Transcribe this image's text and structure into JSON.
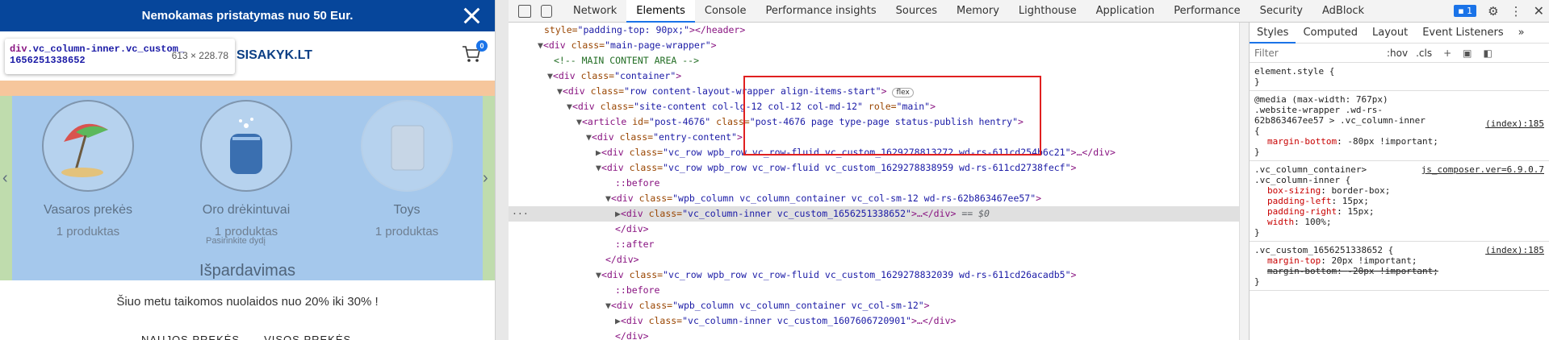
{
  "preview": {
    "promo_text": "Nemokamas pristatymas nuo 50 Eur.",
    "logo_text": "SISAKYK.LT",
    "cart_count": "0",
    "tooltip": {
      "selector_tag": "div",
      "selector_class": ".vc_column-inner.vc_custom_",
      "selector_id_line": "1656251338652",
      "size": "613 × 228.78"
    },
    "categories": [
      {
        "name": "Vasaros prekės",
        "count": "1 produktas",
        "icon": "beach-umbrella-icon"
      },
      {
        "name": "Oro drėkintuvai",
        "count": "1 produktas",
        "icon": "humidifier-icon"
      },
      {
        "name": "Toys",
        "count": "1 produktas",
        "icon": "toy-box-icon"
      }
    ],
    "sub_note": "Pasirinkite dydį",
    "sale_title": "Išpardavimas",
    "sale_subtitle": "Šiuo metu taikomos nuolaidos nuo 20% iki 30% !",
    "bottom_tabs": [
      "NAUJOS PREKĖS",
      "VISOS PREKĖS"
    ]
  },
  "devtools": {
    "tabs": [
      "Network",
      "Elements",
      "Console",
      "Performance insights",
      "Sources",
      "Memory",
      "Lighthouse",
      "Application",
      "Performance",
      "Security",
      "AdBlock"
    ],
    "active_tab": "Elements",
    "issues_count": "1",
    "styles_tabs": [
      "Styles",
      "Computed",
      "Layout",
      "Event Listeners",
      "»"
    ],
    "filter_placeholder": "Filter",
    "hov": ":hov",
    "cls": ".cls",
    "element_style": "element.style {",
    "media_query": "@media (max-width: 767px)",
    "rule1_selector_a": ".website-wrapper .wd-rs-",
    "rule1_selector_b": "62b863467ee57 > .vc_column-inner",
    "rule1_source": "(index):185",
    "rule1_prop": "margin-bottom",
    "rule1_val": "-80px !important;",
    "rule2_selector_a": ".vc_column_container>",
    "rule2_source": "js_composer.ver=6.9.0.7",
    "rule2_selector_b": ".vc_column-inner {",
    "rule2_props": [
      {
        "name": "box-sizing",
        "value": "border-box;"
      },
      {
        "name": "padding-left",
        "value": "15px;"
      },
      {
        "name": "padding-right",
        "value": "15px;"
      },
      {
        "name": "width",
        "value": "100%;"
      }
    ],
    "rule3_selector": ".vc_custom_1656251338652 {",
    "rule3_source": "(index):185",
    "rule3_props": [
      {
        "name": "margin-top",
        "value": "20px !important;"
      },
      {
        "name": "margin-bottom",
        "value": "-20px !important;"
      }
    ]
  }
}
